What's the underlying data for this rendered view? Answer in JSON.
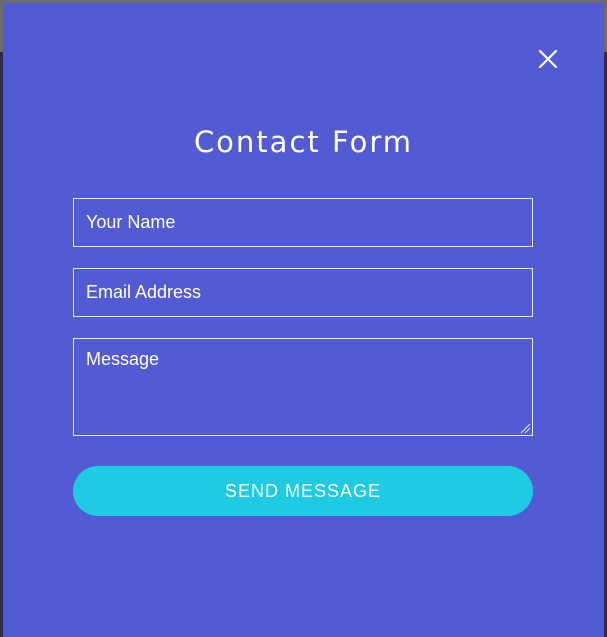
{
  "modal": {
    "title": "Contact Form",
    "close_icon": "close-icon",
    "accent_color": "#525bd3",
    "button_color": "#1ecbe3"
  },
  "form": {
    "name_placeholder": "Your Name",
    "name_value": "",
    "email_placeholder": "Email Address",
    "email_value": "",
    "message_placeholder": "Message",
    "message_value": "",
    "submit_label": "SEND MESSAGE"
  }
}
